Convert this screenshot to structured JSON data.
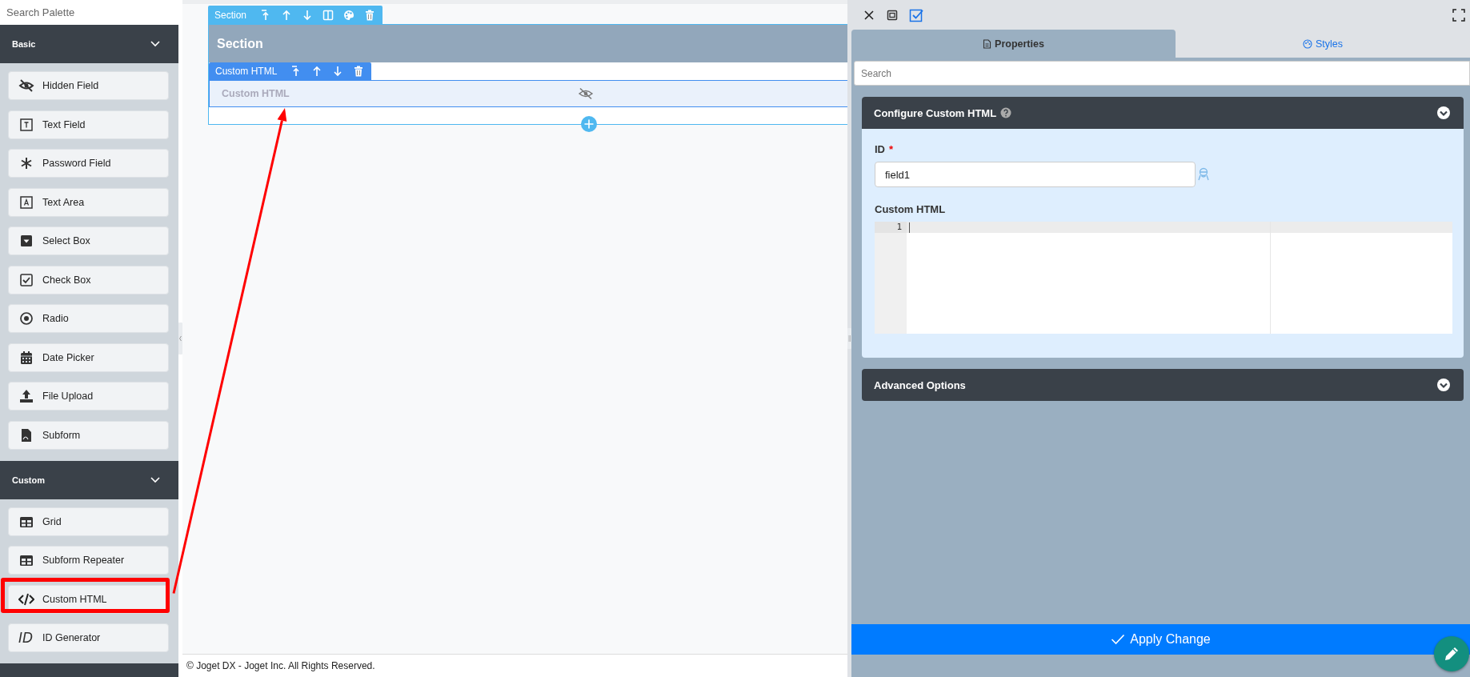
{
  "palette": {
    "search": {
      "placeholder": "Search Palette"
    },
    "groups": [
      {
        "title": "Basic",
        "expanded": true,
        "items": [
          {
            "label": "Hidden Field",
            "kind": "hidden",
            "highlighted": false
          },
          {
            "label": "Text Field",
            "kind": "text",
            "highlighted": false
          },
          {
            "label": "Password Field",
            "kind": "password",
            "highlighted": false
          },
          {
            "label": "Text Area",
            "kind": "textarea",
            "highlighted": false
          },
          {
            "label": "Select Box",
            "kind": "select",
            "highlighted": false
          },
          {
            "label": "Check Box",
            "kind": "checkbox",
            "highlighted": false
          },
          {
            "label": "Radio",
            "kind": "radio",
            "highlighted": false
          },
          {
            "label": "Date Picker",
            "kind": "date",
            "highlighted": false
          },
          {
            "label": "File Upload",
            "kind": "upload",
            "highlighted": false
          },
          {
            "label": "Subform",
            "kind": "subform",
            "highlighted": false
          }
        ]
      },
      {
        "title": "Custom",
        "expanded": true,
        "items": [
          {
            "label": "Grid",
            "kind": "grid",
            "highlighted": false
          },
          {
            "label": "Subform Repeater",
            "kind": "grid",
            "highlighted": false
          },
          {
            "label": "Custom HTML",
            "kind": "code",
            "highlighted": true
          },
          {
            "label": "ID Generator",
            "kind": "id",
            "icon_text": "ID",
            "highlighted": false
          }
        ]
      }
    ]
  },
  "canvas": {
    "section": {
      "toolbar_label": "Section",
      "title": "Section",
      "element": {
        "toolbar_label": "Custom HTML",
        "placeholder": "Custom HTML",
        "hidden": true
      }
    },
    "footer": "© Joget DX - Joget Inc. All Rights Reserved."
  },
  "properties": {
    "tabs": [
      {
        "label": "Properties",
        "selected": true
      },
      {
        "label": "Styles",
        "selected": false
      }
    ],
    "search": {
      "placeholder": "Search"
    },
    "panels": [
      {
        "title": "Configure Custom HTML",
        "expanded": true,
        "help": true,
        "fields": [
          {
            "kind": "text",
            "label": "ID",
            "required_mark": "*",
            "value": "field1"
          },
          {
            "kind": "code",
            "label": "Custom HTML",
            "line_numbers": [
              "1"
            ]
          }
        ]
      },
      {
        "title": "Advanced Options",
        "expanded": false
      }
    ],
    "apply_button": "Apply Change"
  }
}
